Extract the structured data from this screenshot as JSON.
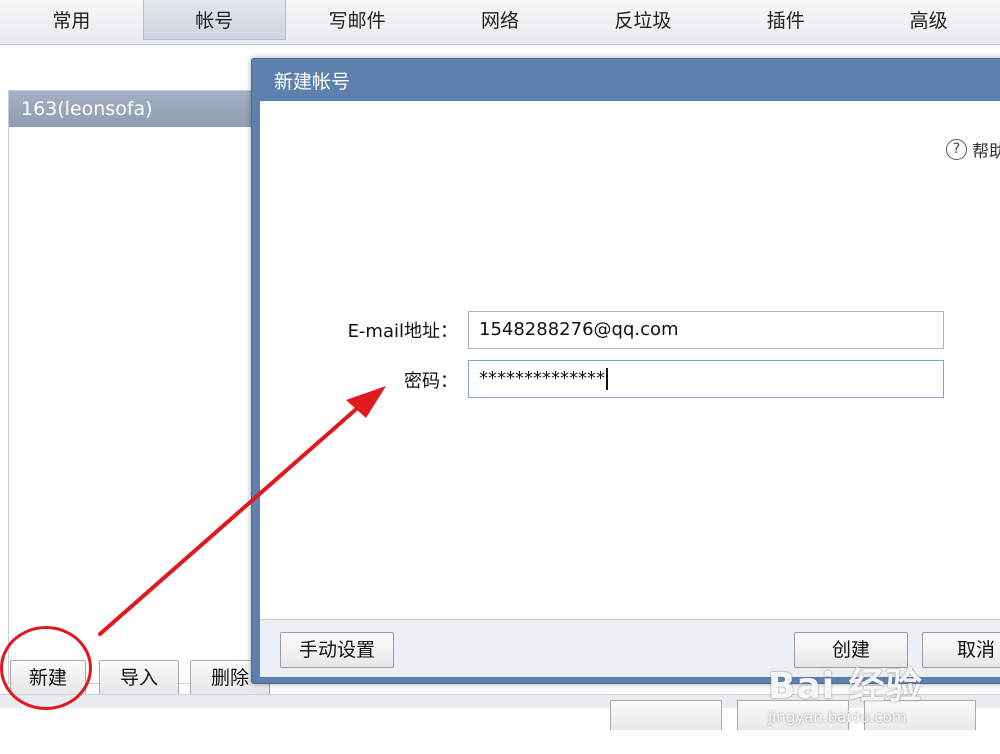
{
  "tabs": [
    "常用",
    "帐号",
    "写邮件",
    "网络",
    "反垃圾",
    "插件",
    "高级"
  ],
  "accounts": [
    "163(leonsofa)"
  ],
  "left_buttons": {
    "new_label": "新建",
    "import_label": "导入",
    "delete_label": "删除"
  },
  "dialog": {
    "title": "新建帐号",
    "help_label": "帮助",
    "email_label": "E-mail地址：",
    "email_value": "1548288276@qq.com",
    "password_label": "密码：",
    "password_value": "**************",
    "manual_setup_label": "手动设置",
    "create_label": "创建",
    "cancel_label": "取消"
  },
  "watermark": {
    "logo": "Bai 经验",
    "url": "jingyan.baidu.com"
  },
  "colors": {
    "dialog_frame": "#5d80ad",
    "selected_account": "#98a6b9",
    "annotation_red": "#e0191f"
  },
  "icons": {
    "help": "question-circle-icon",
    "annotation_arrow": "red-arrow",
    "annotation_circle": "red-circle"
  }
}
